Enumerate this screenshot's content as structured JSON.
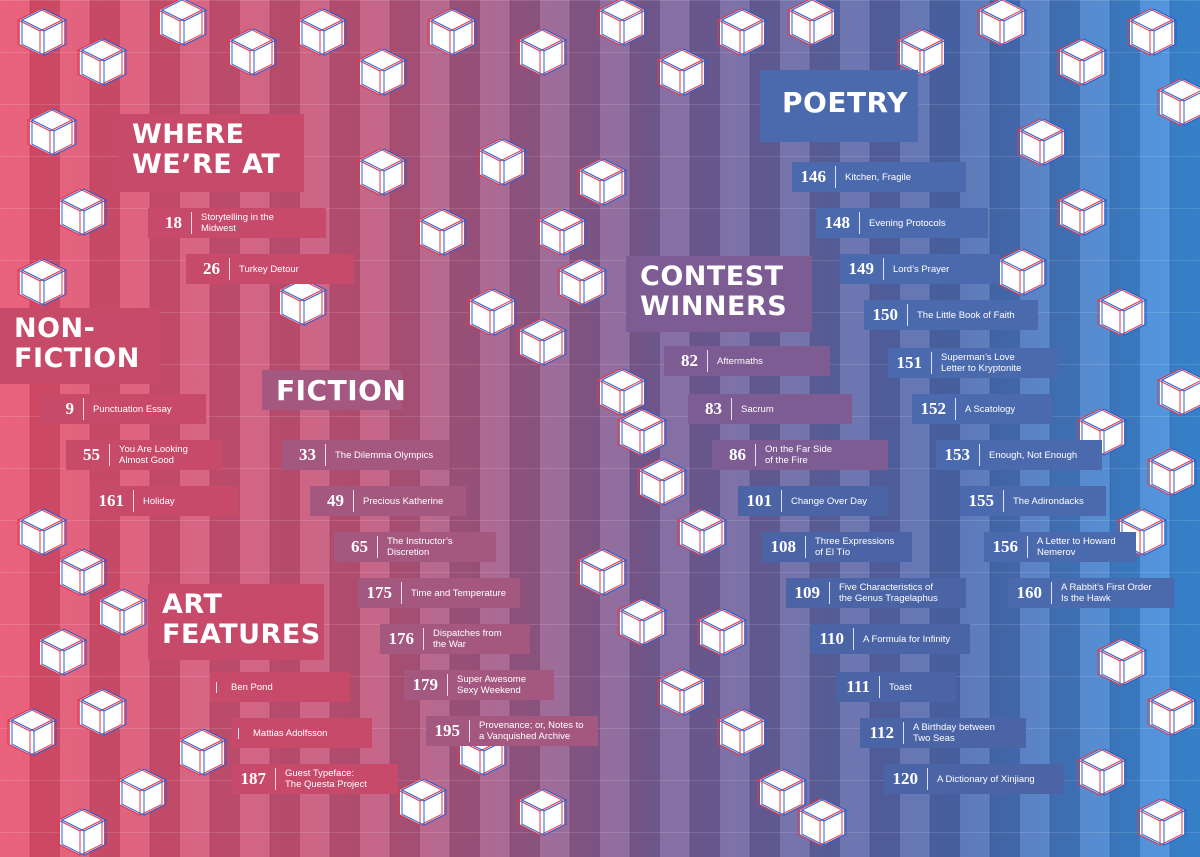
{
  "colors": {
    "red": "#d4486a",
    "mauve": "#a45880",
    "blue": "#4a64a6",
    "light_blue": "#3d8ad8"
  },
  "sections": {
    "where_were_at": {
      "title_line1": "WHERE",
      "title_line2": "WE’RE AT",
      "entries": [
        {
          "page": "18",
          "title_line1": "Storytelling in the",
          "title_line2": "Midwest"
        },
        {
          "page": "26",
          "title_line1": "Turkey Detour",
          "title_line2": ""
        }
      ]
    },
    "nonfiction": {
      "title_line1": "NON-",
      "title_line2": "FICTION",
      "entries": [
        {
          "page": "9",
          "title_line1": "Punctuation Essay",
          "title_line2": ""
        },
        {
          "page": "55",
          "title_line1": "You Are Looking",
          "title_line2": "Almost Good"
        },
        {
          "page": "161",
          "title_line1": "Holiday",
          "title_line2": ""
        }
      ]
    },
    "fiction": {
      "title": "FICTION",
      "entries": [
        {
          "page": "33",
          "title_line1": "The Dilemma Olympics",
          "title_line2": ""
        },
        {
          "page": "49",
          "title_line1": "Precious Katherine",
          "title_line2": ""
        },
        {
          "page": "65",
          "title_line1": "The Instructor’s",
          "title_line2": "Discretion"
        },
        {
          "page": "175",
          "title_line1": "Time and Temperature",
          "title_line2": ""
        },
        {
          "page": "176",
          "title_line1": "Dispatches from",
          "title_line2": "the War"
        },
        {
          "page": "179",
          "title_line1": "Super Awesome",
          "title_line2": "Sexy Weekend"
        },
        {
          "page": "195",
          "title_line1": "Provenance; or, Notes to",
          "title_line2": "a Vanquished Archive"
        }
      ]
    },
    "art_features": {
      "title_line1": "ART",
      "title_line2": "FEATURES",
      "entries": [
        {
          "page": "",
          "title_line1": "Ben Pond",
          "title_line2": ""
        },
        {
          "page": "",
          "title_line1": "Mattias Adolfsson",
          "title_line2": ""
        },
        {
          "page": "187",
          "title_line1": "Guest Typeface:",
          "title_line2": "The Questa Project"
        }
      ]
    },
    "contest_winners": {
      "title_line1": "CONTEST",
      "title_line2": "WINNERS",
      "entries": [
        {
          "page": "82",
          "title_line1": "Aftermaths",
          "title_line2": ""
        },
        {
          "page": "83",
          "title_line1": "Sacrum",
          "title_line2": ""
        },
        {
          "page": "86",
          "title_line1": "On the Far Side",
          "title_line2": "of the Fire"
        },
        {
          "page": "101",
          "title_line1": "Change Over Day",
          "title_line2": ""
        },
        {
          "page": "108",
          "title_line1": "Three Expressions",
          "title_line2": "of El Tío"
        },
        {
          "page": "109",
          "title_line1": "Five Characteristics of",
          "title_line2": "the Genus Tragelaphus"
        },
        {
          "page": "110",
          "title_line1": "A Formula for Infinity",
          "title_line2": ""
        },
        {
          "page": "111",
          "title_line1": "Toast",
          "title_line2": ""
        },
        {
          "page": "112",
          "title_line1": "A Birthday between",
          "title_line2": "Two Seas"
        },
        {
          "page": "120",
          "title_line1": "A Dictionary of Xinjiang",
          "title_line2": ""
        }
      ]
    },
    "poetry": {
      "title": "POETRY",
      "entries": [
        {
          "page": "146",
          "title_line1": "Kitchen, Fragile",
          "title_line2": ""
        },
        {
          "page": "148",
          "title_line1": "Evening Protocols",
          "title_line2": ""
        },
        {
          "page": "149",
          "title_line1": "Lord’s Prayer",
          "title_line2": ""
        },
        {
          "page": "150",
          "title_line1": "The Little Book of Faith",
          "title_line2": ""
        },
        {
          "page": "151",
          "title_line1": "Superman’s Love",
          "title_line2": "Letter to Kryptonite"
        },
        {
          "page": "152",
          "title_line1": "A Scatology",
          "title_line2": ""
        },
        {
          "page": "153",
          "title_line1": "Enough, Not Enough",
          "title_line2": ""
        },
        {
          "page": "155",
          "title_line1": "The Adirondacks",
          "title_line2": ""
        },
        {
          "page": "156",
          "title_line1": "A Letter to Howard",
          "title_line2": "Nemerov"
        },
        {
          "page": "160",
          "title_line1": "A Rabbit’s First Order",
          "title_line2": "Is the Hawk"
        }
      ]
    }
  }
}
